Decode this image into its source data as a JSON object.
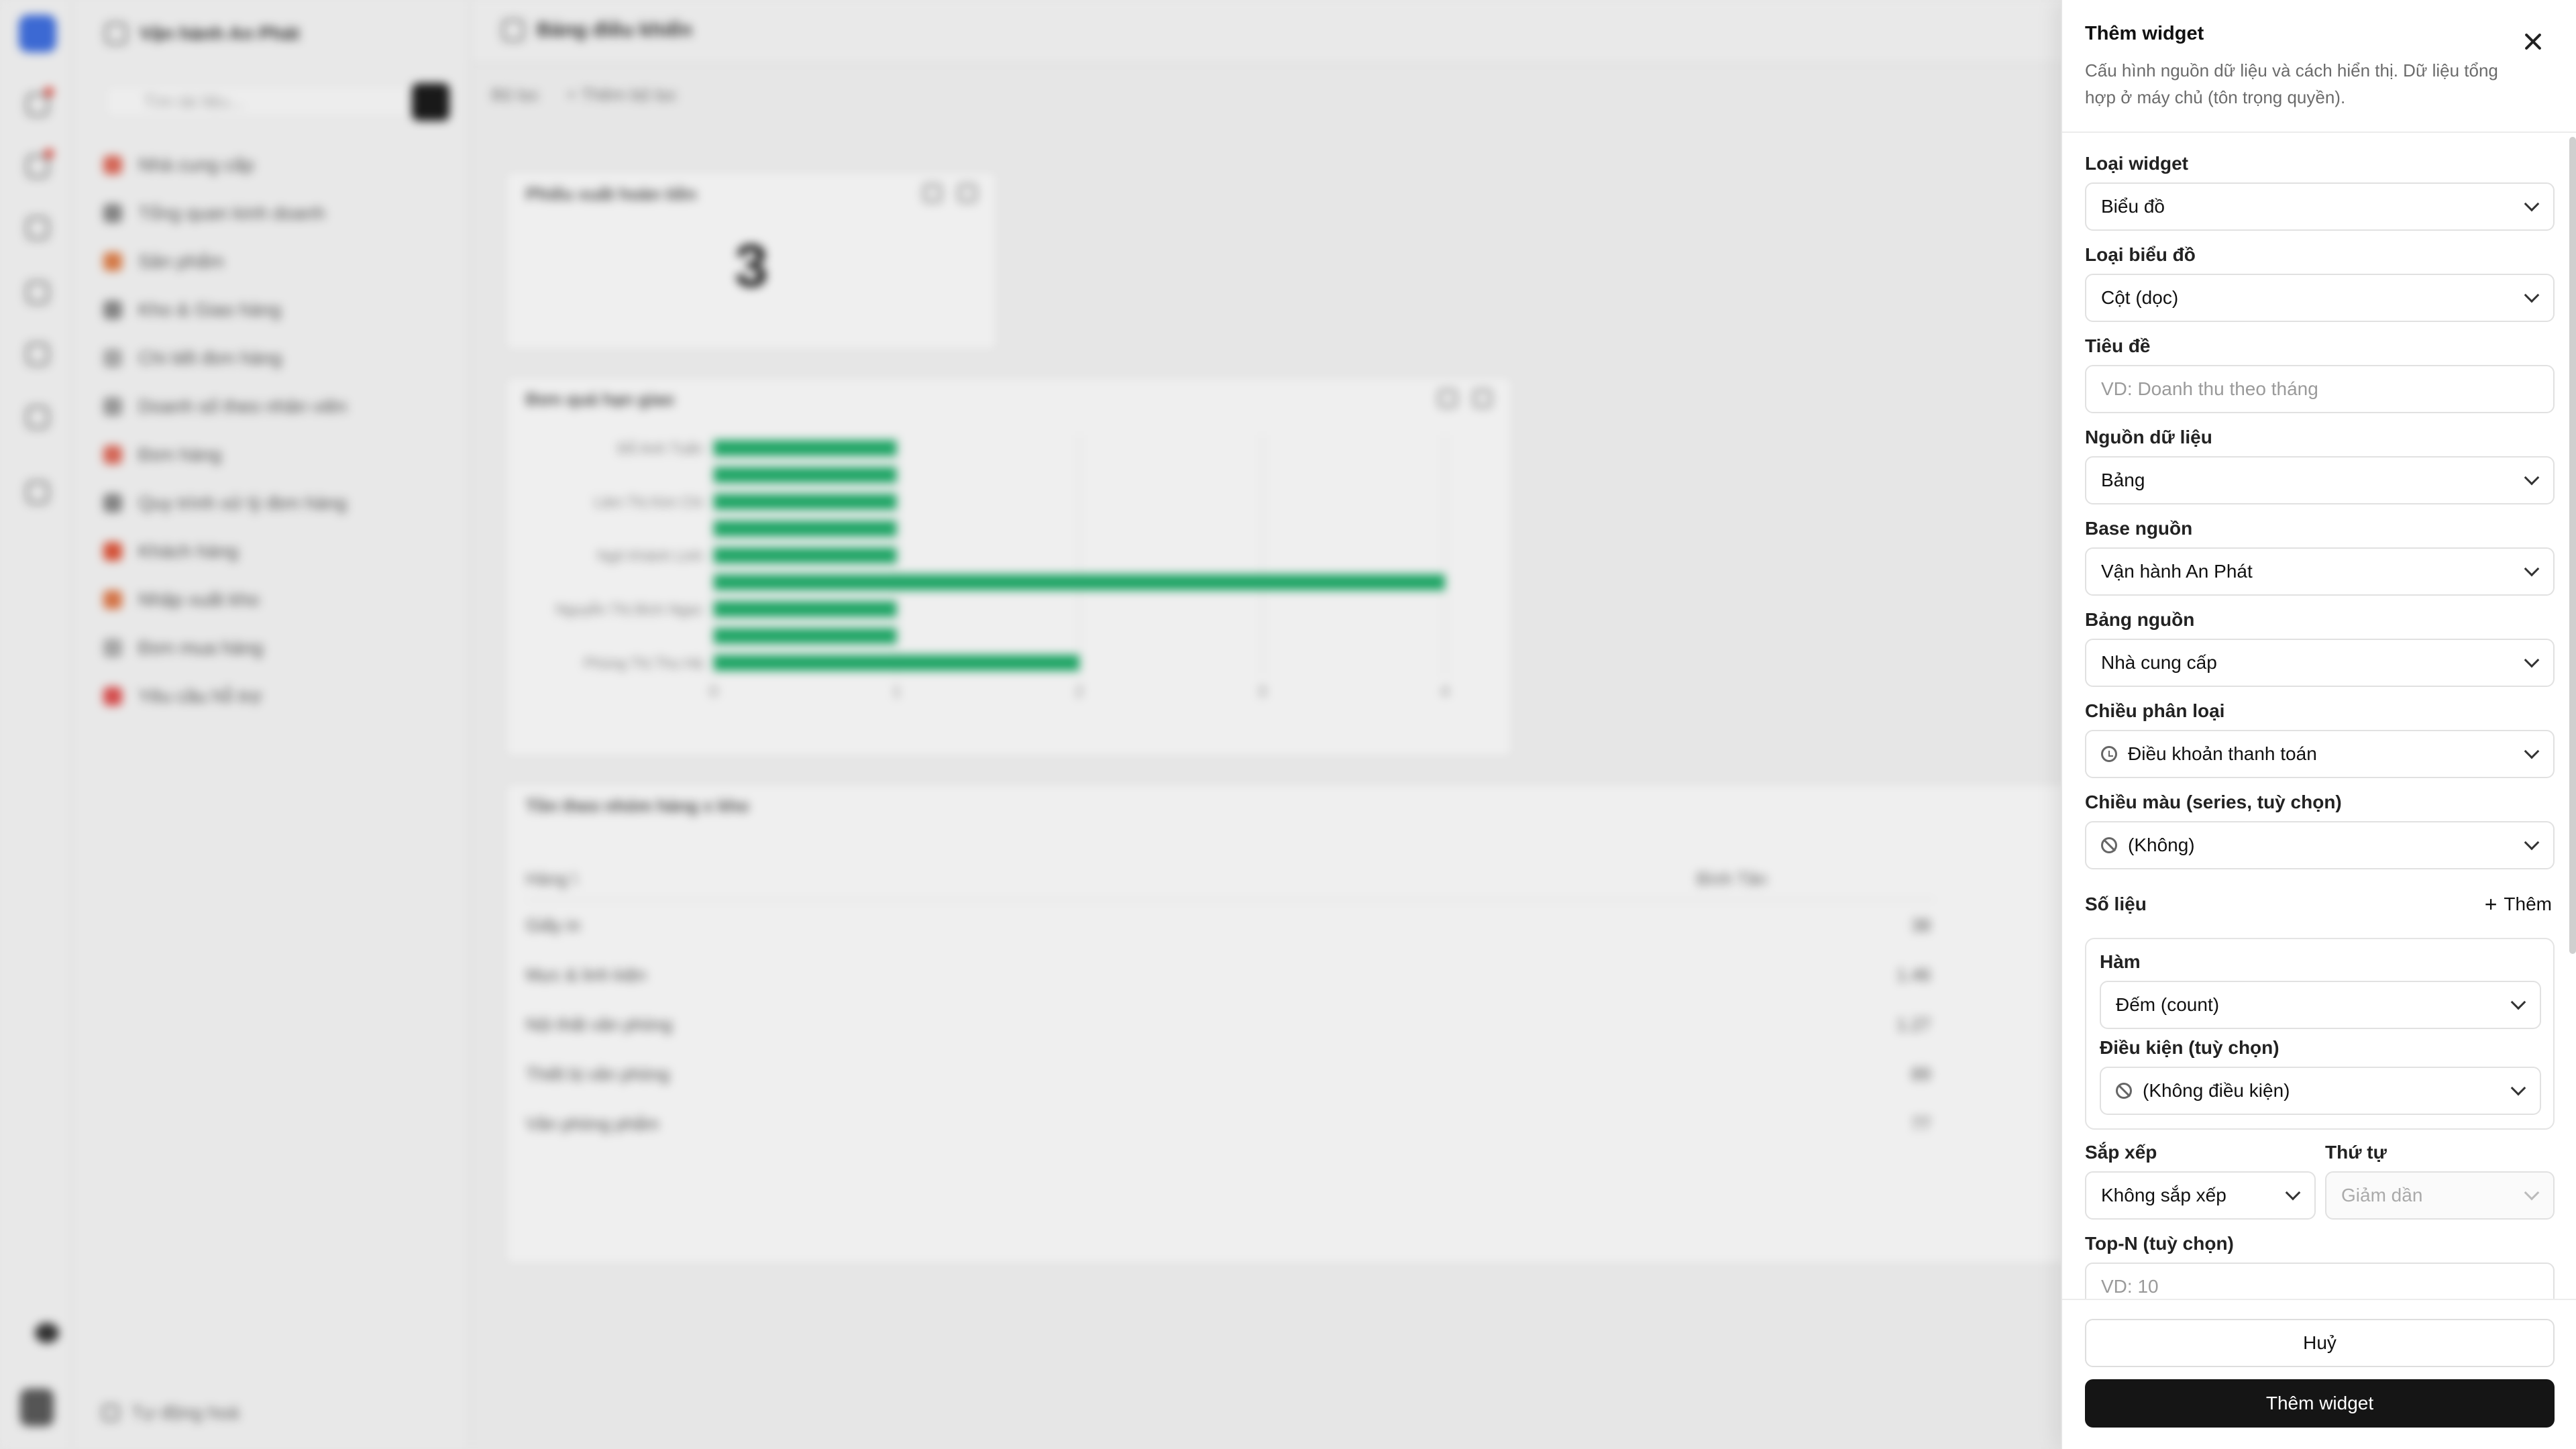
{
  "background": {
    "workspace_name": "Vận hành An Phát",
    "sidebar_search_placeholder": "Tìm tài liệu...",
    "sidebar_items": [
      {
        "label": "Nhà cung cấp",
        "color": "#e06a5a"
      },
      {
        "label": "Tổng quan kinh doanh",
        "color": "#8a8a8a"
      },
      {
        "label": "Sản phẩm",
        "color": "#e0804a"
      },
      {
        "label": "Kho & Giao hàng",
        "color": "#8a8a8a"
      },
      {
        "label": "Chi tiết đơn hàng",
        "color": "#b0b0b0"
      },
      {
        "label": "Doanh số theo nhân viên",
        "color": "#a0a0a0"
      },
      {
        "label": "Đơn hàng",
        "color": "#e06a5a"
      },
      {
        "label": "Quy trình xử lý đơn hàng",
        "color": "#8a8a8a"
      },
      {
        "label": "Khách hàng",
        "color": "#e0553a"
      },
      {
        "label": "Nhập xuất kho",
        "color": "#e07a4a"
      },
      {
        "label": "Đơn mua hàng",
        "color": "#b0b0b0"
      },
      {
        "label": "Yêu cầu hỗ trợ",
        "color": "#e05050"
      }
    ],
    "sidebar_footer": "Tự động hoá",
    "page_title": "Bảng điều khiển",
    "filter_label": "Bộ lọc",
    "add_filter_label": "+ Thêm bộ lọc",
    "kpi_card": {
      "title": "Phiếu xuất hoàn tiền",
      "value": "3"
    },
    "chart_card": {
      "title": "Đơn quá hạn giao"
    },
    "table_card": {
      "title": "Tồn theo nhóm hàng x kho",
      "column_left": "Hàng \\",
      "column_right": "Bình Tân",
      "rows": [
        {
          "name": "Giấy in",
          "value": "38"
        },
        {
          "name": "Mực & linh kiện",
          "value": "1.46"
        },
        {
          "name": "Nội thất văn phòng",
          "value": "1.27"
        },
        {
          "name": "Thiết bị văn phòng",
          "value": "89"
        },
        {
          "name": "Văn phòng phẩm",
          "value": "77"
        }
      ]
    }
  },
  "chart_data": {
    "type": "bar",
    "orientation": "horizontal",
    "categories": [
      "Đỗ Anh Tuấn",
      "",
      "Lâm Thị Kim Chi",
      "",
      "Ngô Khánh Linh",
      "",
      "Nguyễn Thị Bích Ngọc",
      "",
      "Phùng Thị Thu Hà"
    ],
    "values": [
      1,
      1,
      1,
      1,
      1,
      4,
      1,
      1,
      2
    ],
    "xticks": [
      "0",
      "1",
      "2",
      "3",
      "4"
    ],
    "xlim": [
      0,
      4
    ],
    "bar_color": "#1fae6a",
    "grid": true
  },
  "panel": {
    "title": "Thêm widget",
    "description": "Cấu hình nguồn dữ liệu và cách hiển thị. Dữ liệu tổng hợp ở máy chủ (tôn trọng quyền).",
    "fields": {
      "widget_type": {
        "label": "Loại widget",
        "value": "Biểu đồ"
      },
      "chart_type": {
        "label": "Loại biểu đồ",
        "value": "Cột (dọc)"
      },
      "title": {
        "label": "Tiêu đề",
        "placeholder": "VD: Doanh thu theo tháng"
      },
      "data_source": {
        "label": "Nguồn dữ liệu",
        "value": "Bảng"
      },
      "base_source": {
        "label": "Base nguồn",
        "value": "Vận hành An Phát"
      },
      "table_source": {
        "label": "Bảng nguồn",
        "value": "Nhà cung cấp"
      },
      "category_dimension": {
        "label": "Chiều phân loại",
        "value": "Điều khoản thanh toán",
        "icon": "clock-icon"
      },
      "color_dimension": {
        "label": "Chiều màu (series, tuỳ chọn)",
        "value": "(Không)",
        "icon": "ban-icon"
      },
      "sort": {
        "label": "Sắp xếp",
        "value": "Không sắp xếp"
      },
      "order": {
        "label": "Thứ tự",
        "value": "Giảm dần"
      },
      "top_n": {
        "label": "Top-N (tuỳ chọn)",
        "placeholder": "VD: 10"
      }
    },
    "metrics": {
      "label": "Số liệu",
      "add_label": "Thêm",
      "func_label": "Hàm",
      "func_value": "Đếm (count)",
      "condition_label": "Điều kiện (tuỳ chọn)",
      "condition_value": "(Không điều kiện)"
    },
    "cancel_label": "Huỷ",
    "submit_label": "Thêm widget"
  }
}
